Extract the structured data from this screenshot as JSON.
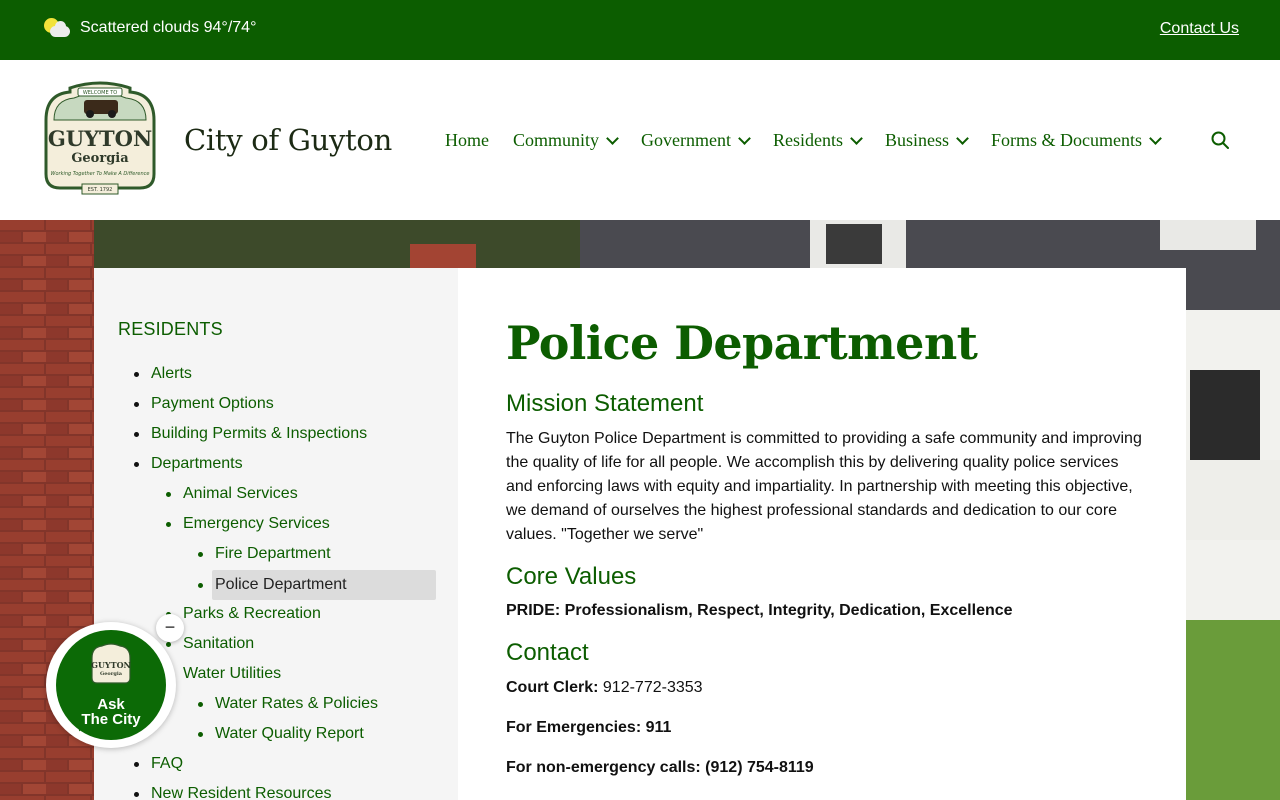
{
  "topbar": {
    "weather_text": "Scattered clouds 94°/74°",
    "contact_label": "Contact Us"
  },
  "header": {
    "site_title": "City of Guyton",
    "logo": {
      "line_welcome": "WELCOME TO",
      "line_city": "GUYTON",
      "line_state": "Georgia",
      "line_slogan": "Working Together To Make A Difference",
      "line_est": "EST. 1792"
    },
    "nav": [
      {
        "label": "Home",
        "has_dropdown": false
      },
      {
        "label": "Community",
        "has_dropdown": true
      },
      {
        "label": "Government",
        "has_dropdown": true
      },
      {
        "label": "Residents",
        "has_dropdown": true
      },
      {
        "label": "Business",
        "has_dropdown": true
      },
      {
        "label": "Forms & Documents",
        "has_dropdown": true
      }
    ]
  },
  "sidebar": {
    "title": "RESIDENTS",
    "items": [
      {
        "label": "Alerts",
        "level": 1
      },
      {
        "label": "Payment Options",
        "level": 1
      },
      {
        "label": "Building Permits & Inspections",
        "level": 1
      },
      {
        "label": "Departments",
        "level": 1
      },
      {
        "label": "Animal Services",
        "level": 2
      },
      {
        "label": "Emergency Services",
        "level": 2
      },
      {
        "label": "Fire Department",
        "level": 3
      },
      {
        "label": "Police Department",
        "level": 3,
        "active": true
      },
      {
        "label": "Parks & Recreation",
        "level": 2
      },
      {
        "label": "Sanitation",
        "level": 2
      },
      {
        "label": "Water Utilities",
        "level": 2
      },
      {
        "label": "Water Rates & Policies",
        "level": 3
      },
      {
        "label": "Water Quality Report",
        "level": 3
      },
      {
        "label": "FAQ",
        "level": 1
      },
      {
        "label": "New Resident Resources",
        "level": 1
      }
    ]
  },
  "main": {
    "title": "Police Department",
    "mission_heading": "Mission Statement",
    "mission_text": "The Guyton Police Department is committed to providing a safe community and improving the quality of life for all people. We accomplish this by delivering quality police services and enforcing laws with equity and impartiality. In partnership with meeting this objective, we demand of ourselves the highest professional standards and dedication to our core values. \"Together we serve\"",
    "values_heading": "Core Values",
    "values_text": "PRIDE: Professionalism, Respect, Integrity, Dedication, Excellence",
    "contact_heading": "Contact",
    "court_clerk_label": "Court Clerk:",
    "court_clerk_value": "912-772-3353",
    "emergency_label": "For Emergencies: 911",
    "nonemergency_label": "For non-emergency calls: (912) 754-8119"
  },
  "chat": {
    "label_line1": "Ask",
    "label_line2": "The City",
    "logo_city": "GUYTON",
    "logo_state": "Georgia",
    "close_symbol": "−"
  },
  "colors": {
    "brand_green": "#0c5d00",
    "sidebar_bg": "#f5f5f5",
    "active_item_bg": "#dcdcdc"
  }
}
